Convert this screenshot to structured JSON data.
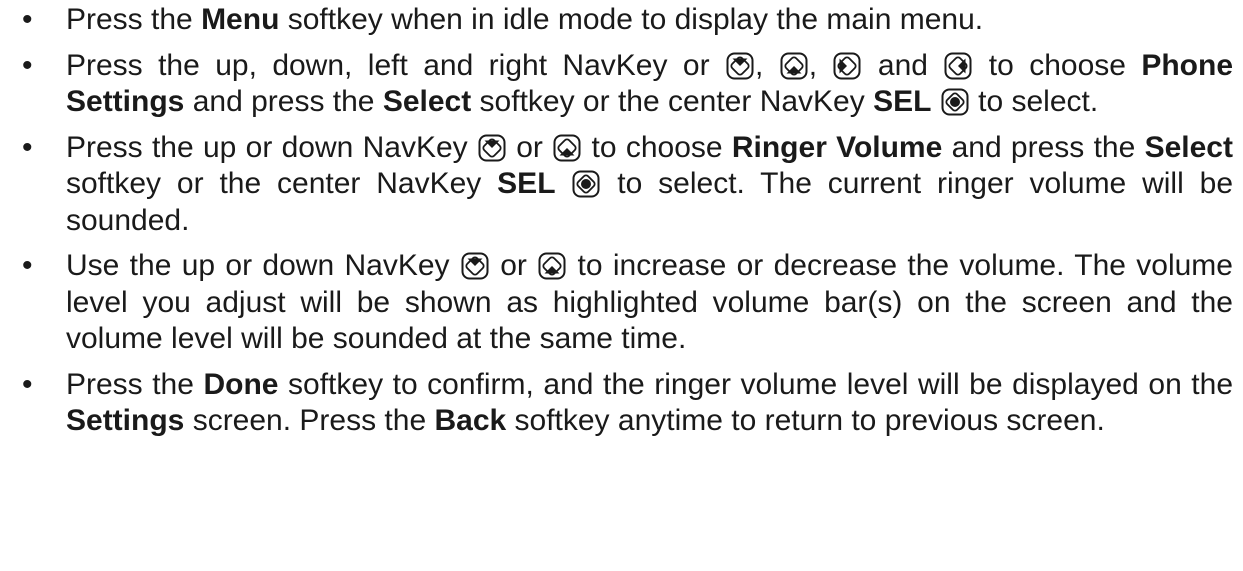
{
  "bullet": "•",
  "icons": {
    "up": "navkey-up-icon",
    "down": "navkey-down-icon",
    "left": "navkey-left-icon",
    "right": "navkey-right-icon",
    "center": "navkey-center-icon"
  },
  "steps": [
    {
      "t1": "Press the ",
      "b1": "Menu",
      "t2": " softkey when in idle mode to display the main menu."
    },
    {
      "t1": "Press the up, down, left and right NavKey or ",
      "sep1": ", ",
      "sep2": ", ",
      "sep3": " and ",
      "t2": " to choose ",
      "b1": "Phone Settings",
      "t3": " and press the ",
      "b2": "Select",
      "t4": " softkey or the center NavKey ",
      "b3": "SEL",
      "t5": " to select."
    },
    {
      "t1": "Press the up or down NavKey ",
      "sep1": " or ",
      "t2": " to choose ",
      "b1": "Ringer Volume",
      "t3": " and press the ",
      "b2": "Select",
      "t4": " softkey or the center NavKey ",
      "b3": "SEL",
      "t5": " to select. The current ringer volume will be sounded."
    },
    {
      "t1": "Use the up or down NavKey ",
      "sep1": " or ",
      "t2": " to increase or decrease the volume. The volume level you adjust will be shown as highlighted volume bar(s) on the screen and the volume level will be sounded at the same time."
    },
    {
      "t1": "Press the ",
      "b1": "Done",
      "t2": " softkey to confirm, and the ringer volume level will be displayed on the ",
      "b2": "Settings",
      "t3": " screen. Press the ",
      "b3": "Back",
      "t4": " softkey anytime to return to previous screen."
    }
  ]
}
